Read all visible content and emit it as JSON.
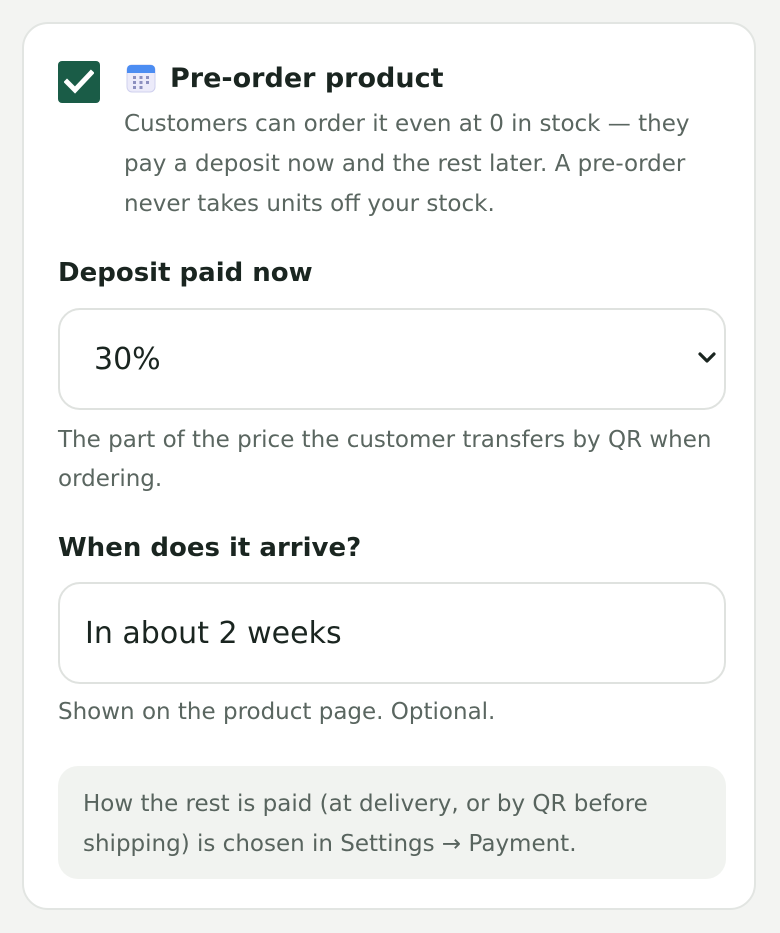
{
  "preorder": {
    "checked": true,
    "icon": "calendar-icon",
    "title": "Pre-order product",
    "description": "Customers can order it even at 0 in stock — they pay a deposit now and the rest later. A pre-order never takes units off your stock."
  },
  "deposit": {
    "label": "Deposit paid now",
    "selected": "30%",
    "help": "The part of the price the customer transfers by QR when ordering."
  },
  "arrival": {
    "label": "When does it arrive?",
    "value": "In about 2 weeks",
    "help": "Shown on the product page. Optional."
  },
  "note": "How the rest is paid (at delivery, or by QR before shipping) is chosen in Settings → Payment.",
  "colors": {
    "accent": "#1a5c47",
    "background": "#f3f4f2",
    "card": "#ffffff",
    "note_background": "#f1f3f0",
    "muted_text": "#5a6660"
  }
}
